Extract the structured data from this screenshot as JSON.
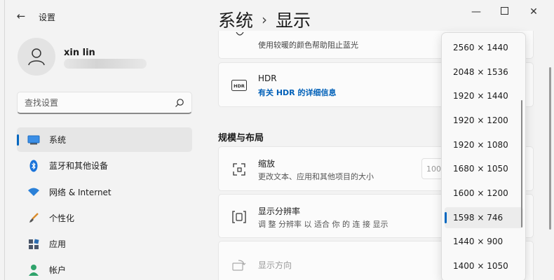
{
  "window": {
    "app_title": "设置",
    "back_icon": "back-arrow-icon",
    "controls": [
      "minimize-icon",
      "maximize-icon",
      "close-icon"
    ]
  },
  "user": {
    "name": "xin lin"
  },
  "search": {
    "placeholder": "查找设置"
  },
  "sidebar": {
    "items": [
      {
        "label": "系统",
        "icon": "monitor-icon",
        "active": true
      },
      {
        "label": "蓝牙和其他设备",
        "icon": "bluetooth-icon",
        "active": false
      },
      {
        "label": "网络 & Internet",
        "icon": "wifi-icon",
        "active": false
      },
      {
        "label": "个性化",
        "icon": "brush-icon",
        "active": false
      },
      {
        "label": "应用",
        "icon": "apps-icon",
        "active": false
      },
      {
        "label": "帐户",
        "icon": "account-icon",
        "active": false
      }
    ]
  },
  "breadcrumb": {
    "parent": "系统",
    "separator": "›",
    "current": "显示"
  },
  "main": {
    "night_light_subtitle": "使用较暖的颜色帮助阻止蓝光",
    "hdr": {
      "badge": "HDR",
      "title": "HDR",
      "link": "有关 HDR 的详细信息"
    },
    "section_heading": "规模与布局",
    "scale": {
      "title": "缩放",
      "subtitle": "更改文本、应用和其他项目的大小",
      "value_partial": "100"
    },
    "resolution": {
      "title": "显示分辨率",
      "subtitle": "调 整 分辨率 以 适合 你 的 连 接 显示"
    },
    "orientation": {
      "title": "显示方向"
    }
  },
  "resolution_dropdown": {
    "options": [
      "2560 × 1440",
      "2048 × 1536",
      "1920 × 1440",
      "1920 × 1200",
      "1920 × 1080",
      "1680 × 1050",
      "1600 × 1200",
      "1598 × 746",
      "1440 × 900",
      "1400 × 1050"
    ],
    "selected_index": 7
  },
  "colors": {
    "accent": "#0067c0",
    "link": "#0060b8",
    "background": "#f3f3f3",
    "card": "#fbfbfb"
  }
}
